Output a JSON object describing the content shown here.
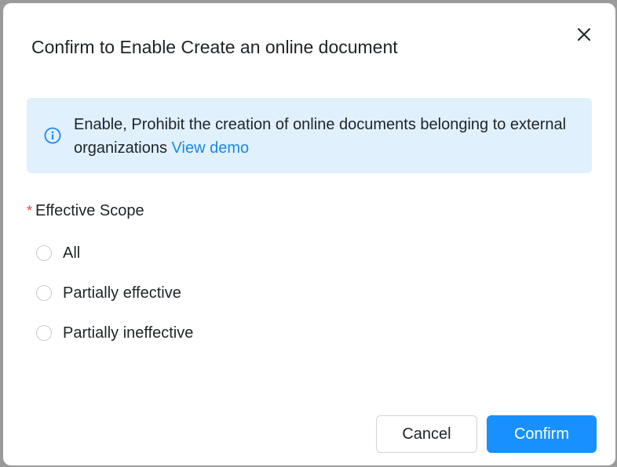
{
  "dialog": {
    "title": "Confirm to Enable Create an online document",
    "info": {
      "text": "Enable, Prohibit the creation of online documents belonging to external organizations",
      "link": "View demo"
    },
    "scope": {
      "required_mark": "*",
      "label": "Effective Scope",
      "options": [
        {
          "label": "All",
          "selected": false
        },
        {
          "label": "Partially effective",
          "selected": false
        },
        {
          "label": "Partially ineffective",
          "selected": false
        }
      ]
    },
    "buttons": {
      "cancel": "Cancel",
      "confirm": "Confirm"
    }
  },
  "colors": {
    "accent": "#1890ff",
    "link": "#1a88e8",
    "info_bg": "#e1f0fd",
    "required": "#e5484d"
  },
  "icons": {
    "close": "close-icon",
    "info": "info-icon"
  }
}
